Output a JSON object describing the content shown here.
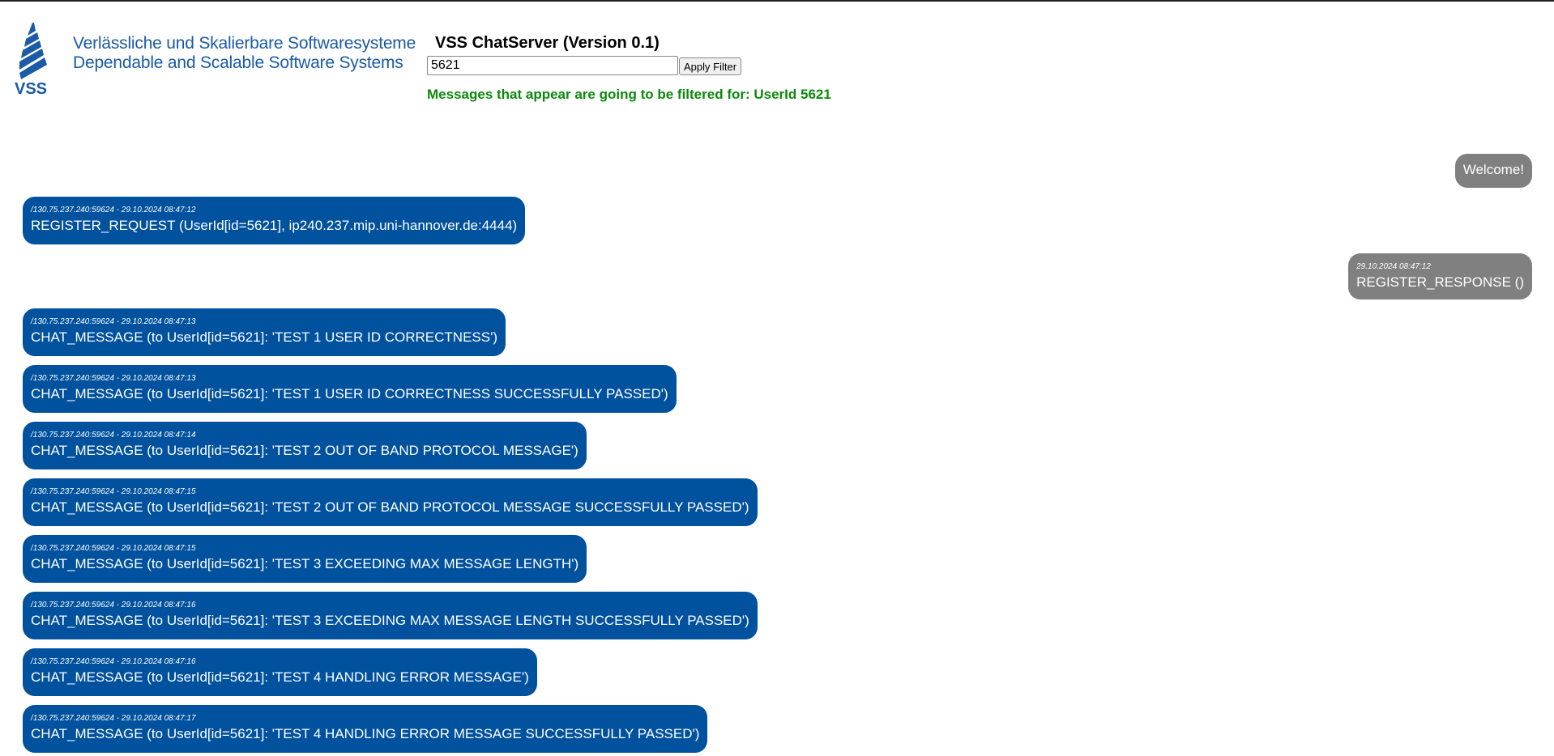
{
  "header": {
    "logo_text": "VSS",
    "subtitle_de": "Verlässliche und Skalierbare Softwaresysteme",
    "subtitle_en": "Dependable and Scalable Software Systems",
    "title": "VSS ChatServer (Version 0.1)",
    "filter_value": "5621",
    "apply_filter_label": "Apply Filter",
    "filter_notice": "Messages that appear are going to be filtered for: UserId 5621"
  },
  "colors": {
    "incoming": "#00519e",
    "outgoing": "#808080",
    "notice": "#0a8a0a"
  },
  "messages": [
    {
      "dir": "out",
      "meta": "",
      "text": "Welcome!"
    },
    {
      "dir": "in",
      "meta": "/130.75.237.240:59624 - 29.10.2024 08:47:12",
      "text": "REGISTER_REQUEST (UserId[id=5621], ip240.237.mip.uni-hannover.de:4444)"
    },
    {
      "dir": "out",
      "meta": "29.10.2024 08:47:12",
      "text": "REGISTER_RESPONSE ()"
    },
    {
      "dir": "in",
      "meta": "/130.75.237.240:59624 - 29.10.2024 08:47:13",
      "text": "CHAT_MESSAGE (to UserId[id=5621]: 'TEST 1 USER ID CORRECTNESS')"
    },
    {
      "dir": "in",
      "meta": "/130.75.237.240:59624 - 29.10.2024 08:47:13",
      "text": "CHAT_MESSAGE (to UserId[id=5621]: 'TEST 1 USER ID CORRECTNESS SUCCESSFULLY PASSED')"
    },
    {
      "dir": "in",
      "meta": "/130.75.237.240:59624 - 29.10.2024 08:47:14",
      "text": "CHAT_MESSAGE (to UserId[id=5621]: 'TEST 2 OUT OF BAND PROTOCOL MESSAGE')"
    },
    {
      "dir": "in",
      "meta": "/130.75.237.240:59624 - 29.10.2024 08:47:15",
      "text": "CHAT_MESSAGE (to UserId[id=5621]: 'TEST 2 OUT OF BAND PROTOCOL MESSAGE SUCCESSFULLY PASSED')"
    },
    {
      "dir": "in",
      "meta": "/130.75.237.240:59624 - 29.10.2024 08:47:15",
      "text": "CHAT_MESSAGE (to UserId[id=5621]: 'TEST 3 EXCEEDING MAX MESSAGE LENGTH')"
    },
    {
      "dir": "in",
      "meta": "/130.75.237.240:59624 - 29.10.2024 08:47:16",
      "text": "CHAT_MESSAGE (to UserId[id=5621]: 'TEST 3 EXCEEDING MAX MESSAGE LENGTH SUCCESSFULLY PASSED')"
    },
    {
      "dir": "in",
      "meta": "/130.75.237.240:59624 - 29.10.2024 08:47:16",
      "text": "CHAT_MESSAGE (to UserId[id=5621]: 'TEST 4 HANDLING ERROR MESSAGE')"
    },
    {
      "dir": "in",
      "meta": "/130.75.237.240:59624 - 29.10.2024 08:47:17",
      "text": "CHAT_MESSAGE (to UserId[id=5621]: 'TEST 4 HANDLING ERROR MESSAGE SUCCESSFULLY PASSED')"
    }
  ]
}
